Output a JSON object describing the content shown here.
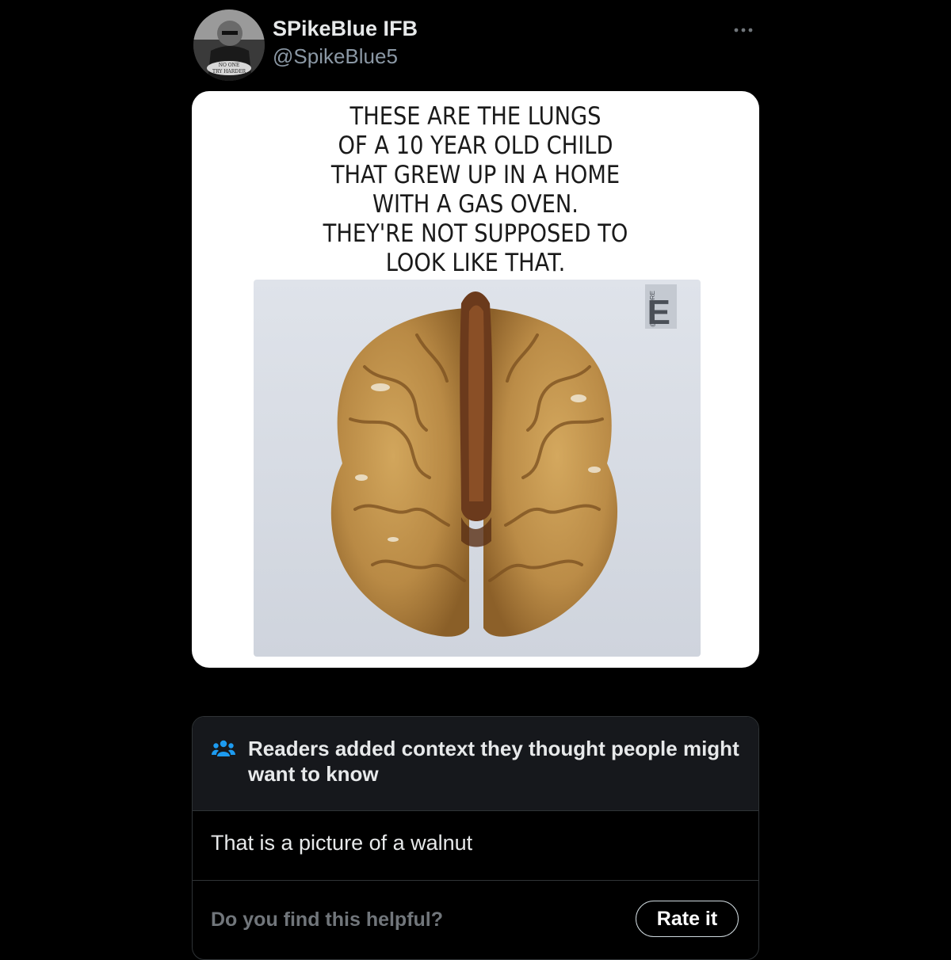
{
  "post": {
    "display_name": "SPikeBlue IFB",
    "handle": "@SpikeBlue5",
    "more_icon": "more-horizontal-icon"
  },
  "media": {
    "caption_lines": [
      "THESE ARE THE LUNGS",
      "OF A 10 YEAR OLD CHILD",
      "THAT GREW UP IN A HOME",
      "WITH A GAS OVEN.",
      "THEY'RE NOT SUPPOSED TO",
      "LOOK LIKE THAT."
    ],
    "watermark_letter": "E",
    "watermark_text": "@EXPLORE"
  },
  "community_note": {
    "icon": "people-icon",
    "header": "Readers added context they thought people might want to know",
    "body": "That is a picture of a walnut",
    "question": "Do you find this helpful?",
    "rate_label": "Rate it",
    "accent_color": "#1d9bf0"
  }
}
